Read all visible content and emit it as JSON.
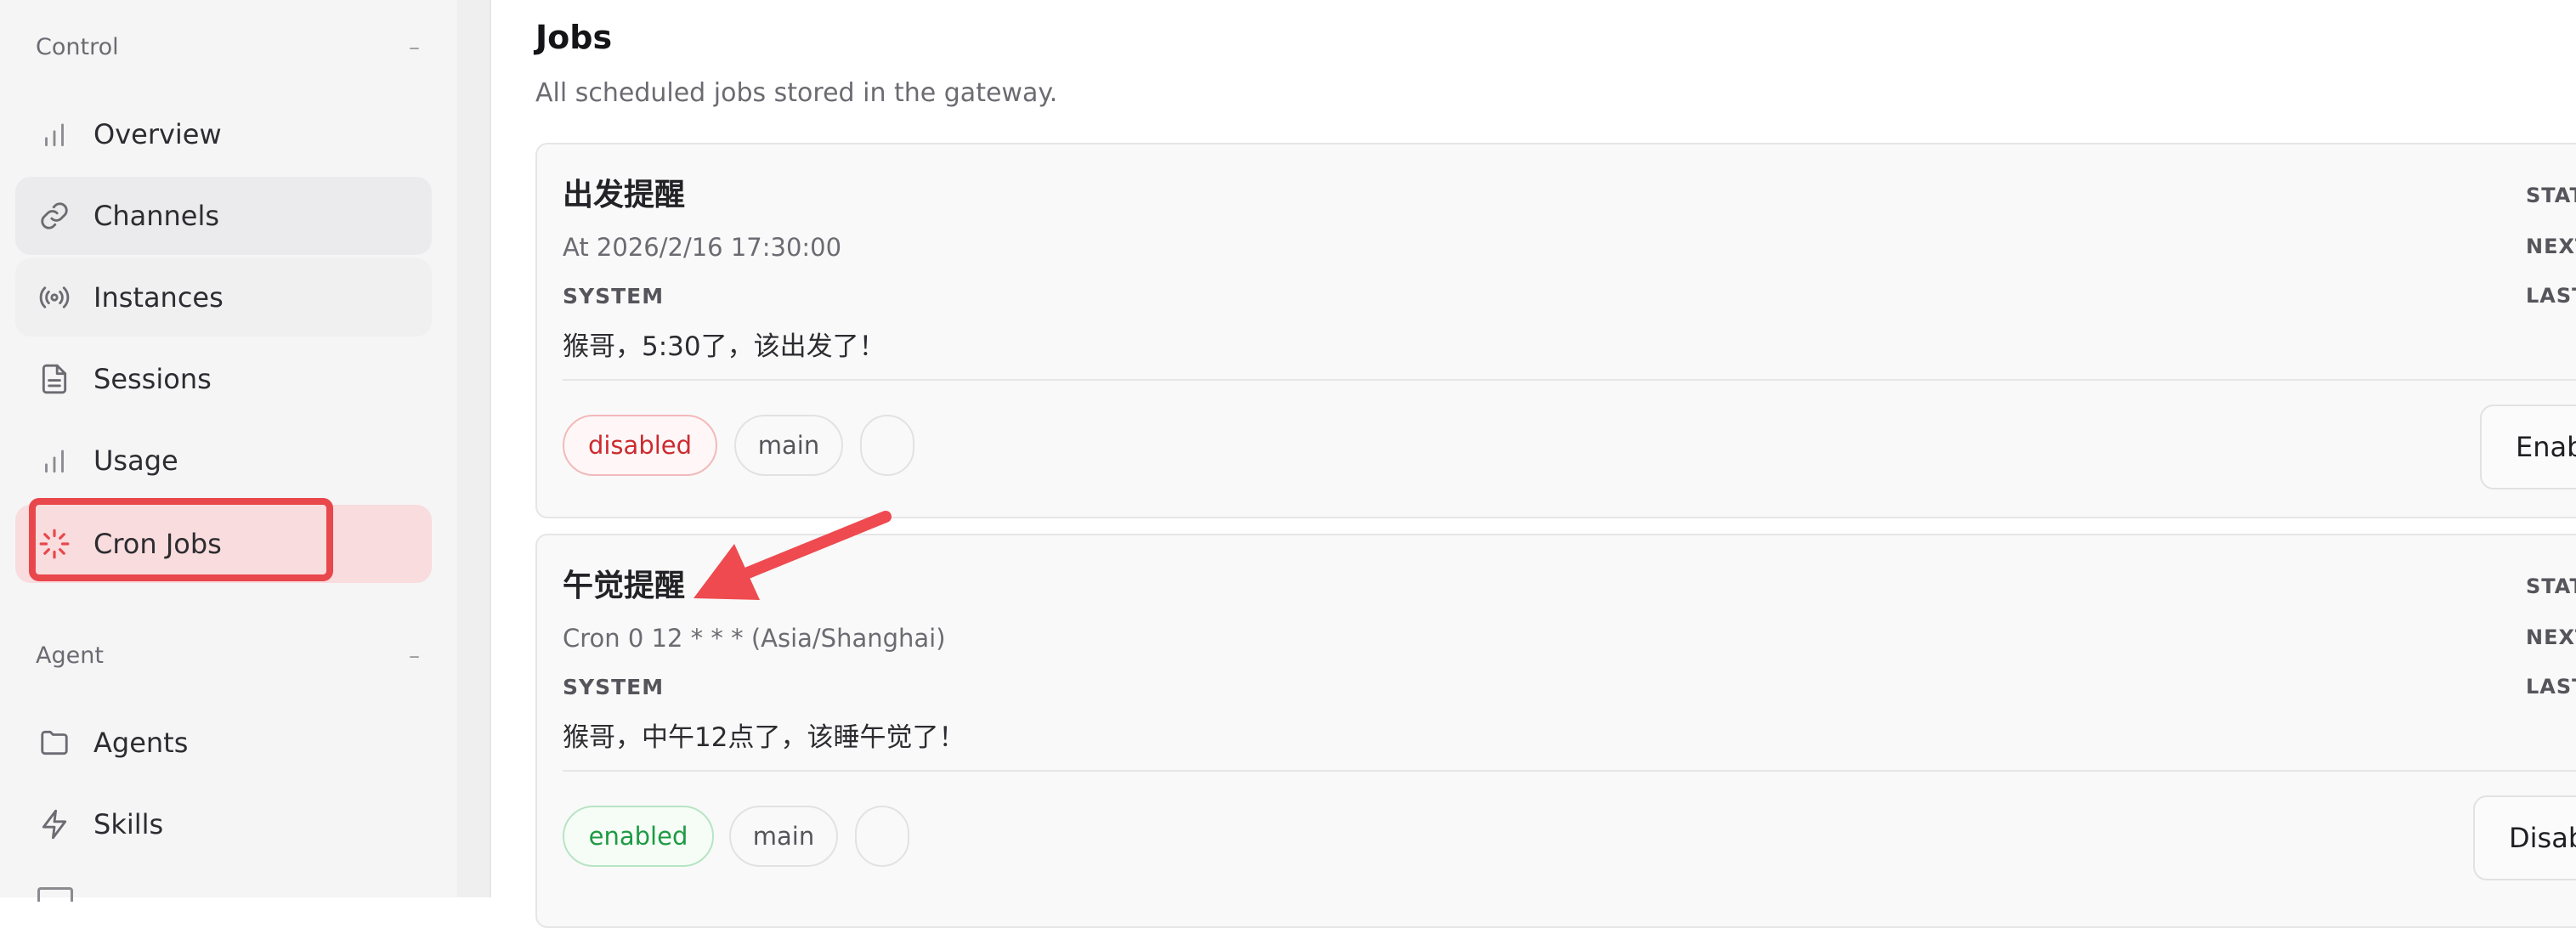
{
  "sidebar": {
    "sections": [
      {
        "title": "Control",
        "collapse": "–"
      },
      {
        "title": "Agent",
        "collapse": "–"
      }
    ],
    "items": [
      {
        "label": "Overview",
        "icon": "bar-chart-icon"
      },
      {
        "label": "Channels",
        "icon": "link-icon"
      },
      {
        "label": "Instances",
        "icon": "broadcast-icon"
      },
      {
        "label": "Sessions",
        "icon": "document-icon"
      },
      {
        "label": "Usage",
        "icon": "bar-chart-icon"
      },
      {
        "label": "Cron Jobs",
        "icon": "loader-icon"
      },
      {
        "label": "Agents",
        "icon": "folder-icon"
      },
      {
        "label": "Skills",
        "icon": "lightning-icon"
      }
    ]
  },
  "main": {
    "title": "Jobs",
    "subtitle": "All scheduled jobs stored in the gateway."
  },
  "jobs": [
    {
      "name": "出发提醒",
      "schedule": "At 2026/2/16 17:30:00",
      "label": "SYSTEM",
      "message": "猴哥，5:30了，该出发了！",
      "status_label": "STATUS",
      "next_label": "NEXT",
      "last_label": "LAST",
      "chips": [
        "disabled",
        "main",
        ""
      ],
      "action": "Enable"
    },
    {
      "name": "午觉提醒",
      "schedule": "Cron 0 12 * * * (Asia/Shanghai)",
      "label": "SYSTEM",
      "message": "猴哥，中午12点了，该睡午觉了！",
      "status_label": "STATUS",
      "next_label": "NEXT",
      "last_label": "LAST",
      "chips": [
        "enabled",
        "main",
        ""
      ],
      "action": "Disable"
    }
  ],
  "colors": {
    "accent": "#e8474c",
    "active_bg": "#f9dcdd",
    "enabled": "#1e9a44",
    "disabled": "#cc2b30"
  }
}
